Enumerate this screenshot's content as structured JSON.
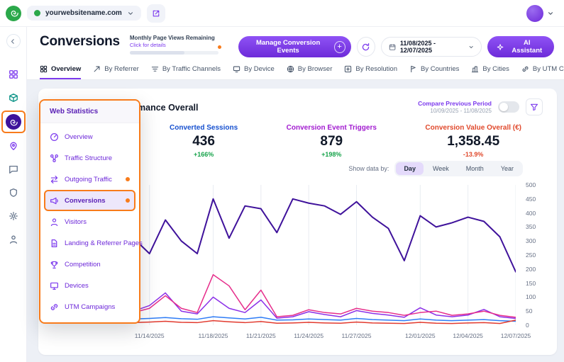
{
  "colors": {
    "accent_purple": "#7C3AED",
    "highlight_orange": "#F87B1B",
    "brand_green": "#2BA84A",
    "positive_green": "#16A34A",
    "negative_red": "#E0492C"
  },
  "topbar": {
    "website": "yourwebsitename.com",
    "icons": [
      "brand-logo",
      "website-dot",
      "chevron-down-icon",
      "external-link-icon",
      "avatar",
      "avatar-chevron-icon"
    ]
  },
  "header": {
    "title": "Conversions",
    "page_views": {
      "label": "Monthly Page Views Remaining",
      "sublabel": "Click for details"
    },
    "manage_button": "Manage Conversion Events",
    "refresh_icon": "refresh-icon",
    "date_range": "11/08/2025 - 12/07/2025",
    "ai_button": "AI Assistant"
  },
  "tabs": [
    {
      "label": "Overview",
      "icon": "grid-icon",
      "active": true
    },
    {
      "label": "By Referrer",
      "icon": "referrer-icon"
    },
    {
      "label": "By Traffic Channels",
      "icon": "traffic-channels-icon"
    },
    {
      "label": "By Device",
      "icon": "device-icon"
    },
    {
      "label": "By Browser",
      "icon": "browser-icon"
    },
    {
      "label": "By Resolution",
      "icon": "resolution-icon"
    },
    {
      "label": "By Countries",
      "icon": "countries-icon"
    },
    {
      "label": "By Cities",
      "icon": "cities-icon"
    },
    {
      "label": "By UTM Campaign",
      "icon": "utm-icon"
    }
  ],
  "rail": {
    "items": [
      "collapse-icon",
      "apps-icon",
      "modules-icon",
      "web-statistics-icon",
      "location-icon",
      "chat-icon",
      "shield-icon",
      "gear-icon",
      "user-icon"
    ],
    "active_item": "web-statistics-icon"
  },
  "menu": {
    "title": "Web Statistics",
    "items": [
      {
        "label": "Overview",
        "icon": "overview-icon"
      },
      {
        "label": "Traffic Structure",
        "icon": "traffic-structure-icon"
      },
      {
        "label": "Outgoing Traffic",
        "icon": "outgoing-traffic-icon",
        "dot": true
      },
      {
        "label": "Conversions",
        "icon": "conversions-icon",
        "dot": true,
        "active": true
      },
      {
        "label": "Visitors",
        "icon": "visitors-icon"
      },
      {
        "label": "Landing & Referrer Pages",
        "icon": "landing-pages-icon"
      },
      {
        "label": "Competition",
        "icon": "competition-icon"
      },
      {
        "label": "Devices",
        "icon": "devices-icon"
      },
      {
        "label": "UTM Campaigns",
        "icon": "utm-campaigns-icon"
      }
    ]
  },
  "panel": {
    "title": "Conversions Performance Overall",
    "compare": {
      "label": "Compare Previous Period",
      "range": "10/09/2025 - 11/08/2025",
      "enabled": false
    },
    "metrics": [
      {
        "label": "Converted Sessions",
        "value": "436",
        "change": "+166%",
        "color": "#1650CF",
        "change_color": "#16A34A"
      },
      {
        "label": "Conversion Event Triggers",
        "value": "879",
        "change": "+198%",
        "color": "#A21CD0",
        "change_color": "#16A34A"
      },
      {
        "label": "Conversion Value Overall (€)",
        "value": "1,358.45",
        "change": "-13.9%",
        "color": "#E0492C",
        "change_color": "#E0492C"
      }
    ],
    "show_data_by": {
      "label": "Show data by:",
      "options": [
        "Day",
        "Week",
        "Month",
        "Year"
      ],
      "selected": "Day"
    }
  },
  "chart_data": {
    "type": "line",
    "x": [
      "11/08/2025",
      "11/09/2025",
      "11/10/2025",
      "11/11/2025",
      "11/12/2025",
      "11/13/2025",
      "11/14/2025",
      "11/15/2025",
      "11/16/2025",
      "11/17/2025",
      "11/18/2025",
      "11/19/2025",
      "11/20/2025",
      "11/21/2025",
      "11/22/2025",
      "11/23/2025",
      "11/24/2025",
      "11/25/2025",
      "11/26/2025",
      "11/27/2025",
      "11/28/2025",
      "11/29/2025",
      "11/30/2025",
      "12/01/2025",
      "12/02/2025",
      "12/03/2025",
      "12/04/2025",
      "12/05/2025",
      "12/06/2025",
      "12/07/2025"
    ],
    "tick_indices": [
      6,
      10,
      13,
      16,
      19,
      23,
      26,
      29
    ],
    "tick_labels": [
      "11/14/2025",
      "11/18/2025",
      "11/21/2025",
      "11/24/2025",
      "11/27/2025",
      "12/01/2025",
      "12/04/2025",
      "12/07/2025"
    ],
    "ylim": [
      0,
      500
    ],
    "ytick_step": 50,
    "grid": "vertical",
    "legend": "none",
    "series": [
      {
        "name": "violet-line",
        "color": "#8B2FE8",
        "values": [
          70,
          90,
          60,
          65,
          85,
          50,
          70,
          115,
          50,
          40,
          100,
          60,
          45,
          90,
          25,
          30,
          48,
          38,
          30,
          52,
          42,
          36,
          28,
          62,
          36,
          30,
          36,
          56,
          30,
          24
        ]
      },
      {
        "name": "magenta-line",
        "color": "#E62E8B",
        "values": [
          60,
          75,
          50,
          55,
          70,
          45,
          60,
          105,
          60,
          45,
          180,
          140,
          55,
          125,
          30,
          35,
          55,
          45,
          40,
          60,
          50,
          45,
          35,
          45,
          50,
          35,
          40,
          50,
          35,
          28
        ]
      },
      {
        "name": "blue-line",
        "color": "#2E7CF6",
        "values": [
          24,
          27,
          23,
          26,
          28,
          22,
          24,
          27,
          23,
          21,
          30,
          26,
          22,
          28,
          18,
          19,
          22,
          20,
          18,
          24,
          20,
          18,
          16,
          22,
          18,
          16,
          18,
          20,
          16,
          14
        ]
      },
      {
        "name": "red-line",
        "color": "#E23A2E",
        "values": [
          10,
          12,
          9,
          11,
          13,
          9,
          11,
          14,
          10,
          9,
          16,
          12,
          9,
          13,
          7,
          8,
          10,
          8,
          7,
          11,
          8,
          7,
          6,
          10,
          7,
          6,
          8,
          9,
          6,
          18
        ]
      },
      {
        "name": "dark-purple-line",
        "color": "#3F129B",
        "values": [
          380,
          410,
          390,
          400,
          430,
          310,
          255,
          375,
          300,
          255,
          450,
          310,
          425,
          415,
          330,
          450,
          435,
          425,
          395,
          440,
          385,
          345,
          230,
          390,
          350,
          365,
          385,
          370,
          315,
          190
        ]
      }
    ]
  }
}
